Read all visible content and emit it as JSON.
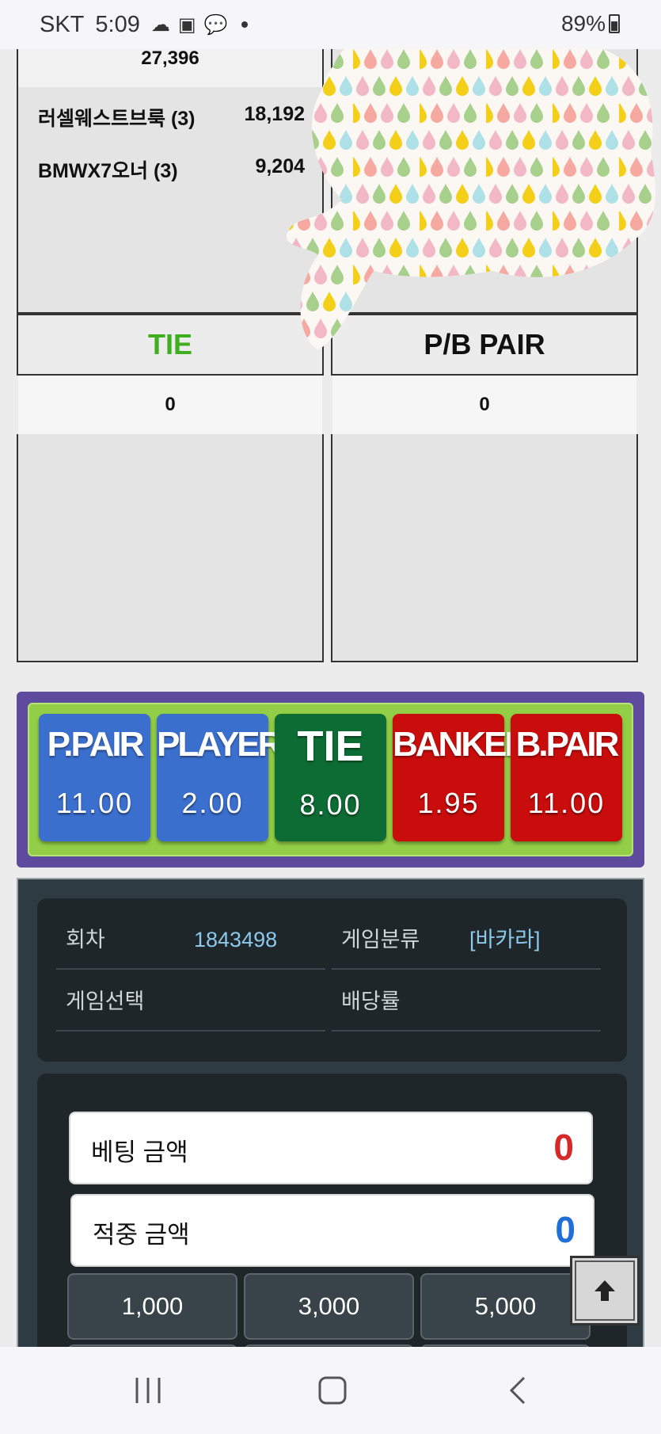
{
  "status_bar": {
    "carrier": "SKT",
    "time": "5:09",
    "battery": "89%"
  },
  "top_panels": {
    "left_score": "27,396",
    "rankings": [
      {
        "name": "러셀웨스트브룩 (3)",
        "score": "18,192"
      },
      {
        "name": "BMWX7오너 (3)",
        "score": "9,204"
      }
    ]
  },
  "tie_panel": {
    "title": "TIE",
    "value": "0",
    "title_color": "#3fae1f"
  },
  "pair_panel": {
    "title": "P/B PAIR",
    "value": "0"
  },
  "bet_options": [
    {
      "name": "P.PAIR",
      "odds": "11.00",
      "color": "#3b6fce"
    },
    {
      "name": "PLAYER",
      "odds": "2.00",
      "color": "#3b6fce"
    },
    {
      "name": "TIE",
      "odds": "8.00",
      "color": "#0d6b34"
    },
    {
      "name": "BANKER",
      "odds": "1.95",
      "color": "#c90c0c"
    },
    {
      "name": "B.PAIR",
      "odds": "11.00",
      "color": "#c90c0c"
    }
  ],
  "game_info": {
    "round_label": "회차",
    "round_value": "1843498",
    "category_label": "게임분류",
    "category_value": "[바카라]",
    "selection_label": "게임선택",
    "selection_value": "",
    "odds_label": "배당률",
    "odds_value": ""
  },
  "amounts": {
    "bet_label": "베팅 금액",
    "bet_value": "0",
    "bet_color": "#d62a2a",
    "win_label": "적중 금액",
    "win_value": "0",
    "win_color": "#1f6fd6"
  },
  "chips": [
    "1,000",
    "3,000",
    "5,000"
  ],
  "icons": {
    "scroll_top": "arrow-up-icon",
    "nav": [
      "recent-apps-icon",
      "home-icon",
      "back-icon"
    ]
  }
}
